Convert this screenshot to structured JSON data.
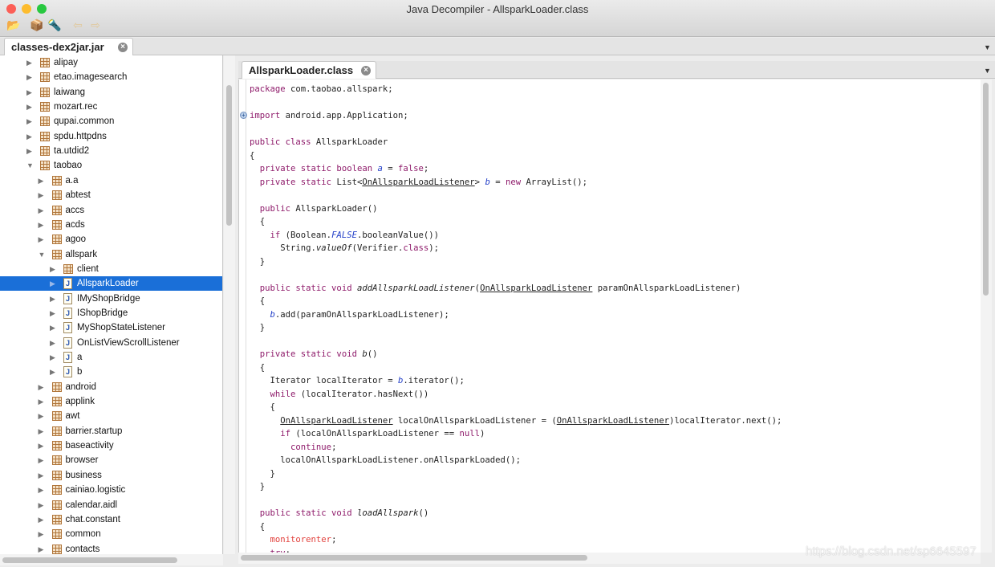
{
  "window": {
    "title": "Java Decompiler - AllsparkLoader.class"
  },
  "toolbar": [
    {
      "icon": "open-file-icon",
      "glyph": "📂"
    },
    {
      "icon": "open-type-icon",
      "glyph": "📦"
    },
    {
      "icon": "search-icon",
      "glyph": "🔦"
    },
    {
      "icon": "back-arrow-icon",
      "glyph": "⇦"
    },
    {
      "icon": "forward-arrow-icon",
      "glyph": "⇨"
    }
  ],
  "left_tab": {
    "label": "classes-dex2jar.jar"
  },
  "right_tab": {
    "label": "AllsparkLoader.class"
  },
  "tree": [
    {
      "label": "alipay",
      "level": 1,
      "type": "package"
    },
    {
      "label": "etao.imagesearch",
      "level": 1,
      "type": "package"
    },
    {
      "label": "laiwang",
      "level": 1,
      "type": "package"
    },
    {
      "label": "mozart.rec",
      "level": 1,
      "type": "package"
    },
    {
      "label": "qupai.common",
      "level": 1,
      "type": "package"
    },
    {
      "label": "spdu.httpdns",
      "level": 1,
      "type": "package"
    },
    {
      "label": "ta.utdid2",
      "level": 1,
      "type": "package"
    },
    {
      "label": "taobao",
      "level": 1,
      "type": "package",
      "expanded": true
    },
    {
      "label": "a.a",
      "level": 2,
      "type": "package"
    },
    {
      "label": "abtest",
      "level": 2,
      "type": "package"
    },
    {
      "label": "accs",
      "level": 2,
      "type": "package"
    },
    {
      "label": "acds",
      "level": 2,
      "type": "package"
    },
    {
      "label": "agoo",
      "level": 2,
      "type": "package"
    },
    {
      "label": "allspark",
      "level": 2,
      "type": "package",
      "expanded": true
    },
    {
      "label": "client",
      "level": 3,
      "type": "package"
    },
    {
      "label": "AllsparkLoader",
      "level": 3,
      "type": "class",
      "selected": true
    },
    {
      "label": "IMyShopBridge",
      "level": 3,
      "type": "class"
    },
    {
      "label": "IShopBridge",
      "level": 3,
      "type": "class"
    },
    {
      "label": "MyShopStateListener",
      "level": 3,
      "type": "class"
    },
    {
      "label": "OnListViewScrollListener",
      "level": 3,
      "type": "class"
    },
    {
      "label": "a",
      "level": 3,
      "type": "class"
    },
    {
      "label": "b",
      "level": 3,
      "type": "class"
    },
    {
      "label": "android",
      "level": 2,
      "type": "package"
    },
    {
      "label": "applink",
      "level": 2,
      "type": "package"
    },
    {
      "label": "awt",
      "level": 2,
      "type": "package"
    },
    {
      "label": "barrier.startup",
      "level": 2,
      "type": "package"
    },
    {
      "label": "baseactivity",
      "level": 2,
      "type": "package"
    },
    {
      "label": "browser",
      "level": 2,
      "type": "package"
    },
    {
      "label": "business",
      "level": 2,
      "type": "package"
    },
    {
      "label": "cainiao.logistic",
      "level": 2,
      "type": "package"
    },
    {
      "label": "calendar.aidl",
      "level": 2,
      "type": "package"
    },
    {
      "label": "chat.constant",
      "level": 2,
      "type": "package"
    },
    {
      "label": "common",
      "level": 2,
      "type": "package"
    },
    {
      "label": "contacts",
      "level": 2,
      "type": "package"
    }
  ],
  "code": [
    [
      [
        "package",
        "k"
      ],
      [
        " com.taobao.allspark;",
        ""
      ]
    ],
    [],
    [
      [
        "import",
        "k"
      ],
      [
        " android.app.Application;",
        ""
      ]
    ],
    [],
    [
      [
        "public class",
        "k"
      ],
      [
        " AllsparkLoader",
        ""
      ]
    ],
    [
      [
        "{",
        ""
      ]
    ],
    [
      [
        "  ",
        ""
      ],
      [
        "private static boolean",
        "k"
      ],
      [
        " ",
        ""
      ],
      [
        "a",
        "f"
      ],
      [
        " = ",
        ""
      ],
      [
        "false",
        "k"
      ],
      [
        ";",
        ""
      ]
    ],
    [
      [
        "  ",
        ""
      ],
      [
        "private static",
        "k"
      ],
      [
        " List<",
        ""
      ],
      [
        "OnAllsparkLoadListener",
        "u"
      ],
      [
        "> ",
        ""
      ],
      [
        "b",
        "f"
      ],
      [
        " = ",
        ""
      ],
      [
        "new",
        "k"
      ],
      [
        " ArrayList();",
        ""
      ]
    ],
    [],
    [
      [
        "  ",
        ""
      ],
      [
        "public",
        "k"
      ],
      [
        " AllsparkLoader()",
        ""
      ]
    ],
    [
      [
        "  {",
        ""
      ]
    ],
    [
      [
        "    ",
        ""
      ],
      [
        "if",
        "k"
      ],
      [
        " (Boolean.",
        ""
      ],
      [
        "FALSE",
        "fs"
      ],
      [
        ".booleanValue())",
        ""
      ]
    ],
    [
      [
        "      String.",
        ""
      ],
      [
        "valueOf",
        "m"
      ],
      [
        "(Verifier.",
        ""
      ],
      [
        "class",
        "k"
      ],
      [
        ");",
        ""
      ]
    ],
    [
      [
        "  }",
        ""
      ]
    ],
    [],
    [
      [
        "  ",
        ""
      ],
      [
        "public static void",
        "k"
      ],
      [
        " ",
        ""
      ],
      [
        "addAllsparkLoadListener",
        "m"
      ],
      [
        "(",
        ""
      ],
      [
        "OnAllsparkLoadListener",
        "u"
      ],
      [
        " paramOnAllsparkLoadListener)",
        ""
      ]
    ],
    [
      [
        "  {",
        ""
      ]
    ],
    [
      [
        "    ",
        ""
      ],
      [
        "b",
        "f"
      ],
      [
        ".add(paramOnAllsparkLoadListener);",
        ""
      ]
    ],
    [
      [
        "  }",
        ""
      ]
    ],
    [],
    [
      [
        "  ",
        ""
      ],
      [
        "private static void",
        "k"
      ],
      [
        " ",
        ""
      ],
      [
        "b",
        "m"
      ],
      [
        "()",
        ""
      ]
    ],
    [
      [
        "  {",
        ""
      ]
    ],
    [
      [
        "    Iterator localIterator = ",
        ""
      ],
      [
        "b",
        "f"
      ],
      [
        ".iterator();",
        ""
      ]
    ],
    [
      [
        "    ",
        ""
      ],
      [
        "while",
        "k"
      ],
      [
        " (localIterator.hasNext())",
        ""
      ]
    ],
    [
      [
        "    {",
        ""
      ]
    ],
    [
      [
        "      ",
        ""
      ],
      [
        "OnAllsparkLoadListener",
        "u"
      ],
      [
        " localOnAllsparkLoadListener = (",
        ""
      ],
      [
        "OnAllsparkLoadListener",
        "u"
      ],
      [
        ")localIterator.next();",
        ""
      ]
    ],
    [
      [
        "      ",
        ""
      ],
      [
        "if",
        "k"
      ],
      [
        " (localOnAllsparkLoadListener == ",
        ""
      ],
      [
        "null",
        "k"
      ],
      [
        ")",
        ""
      ]
    ],
    [
      [
        "        ",
        ""
      ],
      [
        "continue",
        "k"
      ],
      [
        ";",
        ""
      ]
    ],
    [
      [
        "      localOnAllsparkLoadListener.onAllsparkLoaded();",
        ""
      ]
    ],
    [
      [
        "    }",
        ""
      ]
    ],
    [
      [
        "  }",
        ""
      ]
    ],
    [],
    [
      [
        "  ",
        ""
      ],
      [
        "public static void",
        "k"
      ],
      [
        " ",
        ""
      ],
      [
        "loadAllspark",
        "m"
      ],
      [
        "()",
        ""
      ]
    ],
    [
      [
        "  {",
        ""
      ]
    ],
    [
      [
        "    ",
        ""
      ],
      [
        "monitorenter",
        "r"
      ],
      [
        ";",
        ""
      ]
    ],
    [
      [
        "    ",
        ""
      ],
      [
        "try",
        "k"
      ],
      [
        ";",
        ""
      ]
    ]
  ],
  "watermark": "https://blog.csdn.net/sp6645597",
  "colors": {
    "selection": "#1a6fd8",
    "keyword": "#8e1a6a",
    "field": "#2440c8",
    "monitor": "#e2403c"
  }
}
